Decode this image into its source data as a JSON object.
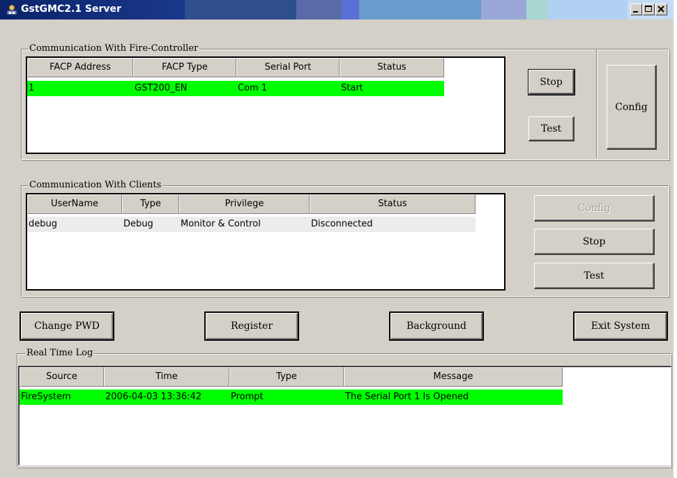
{
  "window": {
    "title": "GstGMC2.1 Server"
  },
  "fire_controller": {
    "legend": "Communication With Fire-Controller",
    "columns": [
      "FACP Address",
      "FACP Type",
      "Serial Port",
      "Status"
    ],
    "rows": [
      {
        "address": "1",
        "type": "GST200_EN",
        "port": "Com 1",
        "status": "Start"
      }
    ],
    "buttons": {
      "stop": "Stop",
      "test": "Test",
      "config": "Config"
    }
  },
  "clients": {
    "legend": "Communication With Clients",
    "columns": [
      "UserName",
      "Type",
      "Privilege",
      "Status"
    ],
    "rows": [
      {
        "username": "debug",
        "type": "Debug",
        "privilege": "Monitor & Control",
        "status": "Disconnected"
      }
    ],
    "buttons": {
      "config": "Config",
      "stop": "Stop",
      "test": "Test"
    }
  },
  "actions": {
    "change_pwd": "Change PWD",
    "register": "Register",
    "background": "Background",
    "exit": "Exit System"
  },
  "log": {
    "legend": "Real Time Log",
    "columns": [
      "Source",
      "Time",
      "Type",
      "Message"
    ],
    "rows": [
      {
        "source": "FireSystem",
        "time": "2006-04-03 13:36:42",
        "type": "Prompt",
        "message": "The Serial Port 1 Is Opened"
      }
    ]
  },
  "colors": {
    "highlight_green": "#00ff00",
    "selected_row_gray": "#ececec",
    "title_dark": "#0a246a"
  }
}
